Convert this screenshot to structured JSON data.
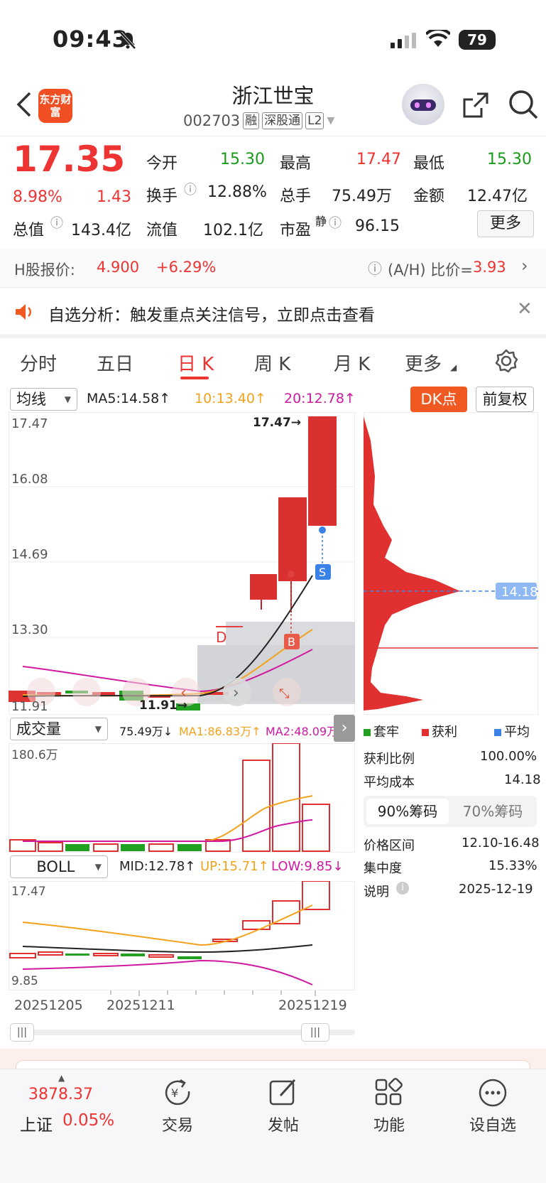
{
  "status_bar": {
    "time": "09:43",
    "battery": "79"
  },
  "header": {
    "title": "浙江世宝",
    "code": "002703",
    "tags": [
      "融",
      "深股通",
      "L2"
    ],
    "logo_text": "东方财富"
  },
  "quote": {
    "price": "17.35",
    "change_pct": "8.98%",
    "change": "1.43",
    "open_label": "今开",
    "open": "15.30",
    "high_label": "最高",
    "high": "17.47",
    "low_label": "最低",
    "low": "15.30",
    "turnover_label": "换手",
    "turnover": "12.88%",
    "volume_label": "总手",
    "volume": "75.49万",
    "amount_label": "金额",
    "amount": "12.47亿",
    "mktcap_label": "总值",
    "mktcap": "143.4亿",
    "float_label": "流值",
    "float_cap": "102.1亿",
    "pe_label": "市盈",
    "pe_sup": "静",
    "pe": "96.15",
    "more_button": "更多"
  },
  "hshare": {
    "label": "H股报价:",
    "price": "4.900",
    "change": "+6.29%",
    "ah_label": "(A/H) 比价=",
    "ah_value": "3.93"
  },
  "notice": {
    "text": "自选分析：触发重点关注信号，立即点击查看"
  },
  "tabs": [
    "分时",
    "五日",
    "日 K",
    "周 K",
    "月 K",
    "更多"
  ],
  "active_tab": "日 K",
  "kline": {
    "indicator": "均线",
    "ma5": "MA5:14.58↑",
    "ma10": "10:13.40↑",
    "ma20": "20:12.78↑",
    "dk_button": "DK点",
    "adjust_button": "前复权",
    "price_labels": [
      "17.47",
      "16.08",
      "14.69",
      "13.30",
      "11.91"
    ],
    "high_marker": "17.47→",
    "low_marker": "11.91→",
    "marker_b": "B",
    "marker_s": "S",
    "marker_d": "D",
    "cost_line_label": "14.18"
  },
  "chip": {
    "legend": [
      "套牢",
      "获利",
      "平均"
    ],
    "profit_ratio_label": "获利比例",
    "profit_ratio": "100.00%",
    "avg_cost_label": "平均成本",
    "avg_cost": "14.18",
    "tab_90": "90%筹码",
    "tab_70": "70%筹码",
    "range_label": "价格区间",
    "range": "12.10-16.48",
    "concentration_label": "集中度",
    "concentration": "15.33%",
    "note_label": "说明",
    "date": "2025-12-19"
  },
  "volume": {
    "indicator": "成交量",
    "vol": "75.49万↓",
    "ma1": "MA1:86.83万↑",
    "ma2": "MA2:48.09万↑",
    "max_label": "180.6万"
  },
  "boll": {
    "indicator": "BOLL",
    "mid": "MID:12.78↑",
    "up": "UP:15.71↑",
    "low": "LOW:9.85↓",
    "top_label": "17.47",
    "bottom_label": "9.85"
  },
  "dates": [
    "20251205",
    "20251211",
    "20251219"
  ],
  "bottom": {
    "index_value": "3878.37",
    "index_name": "上证",
    "index_change": "0.05%",
    "nav": [
      "交易",
      "发帖",
      "功能",
      "设自选"
    ]
  }
}
